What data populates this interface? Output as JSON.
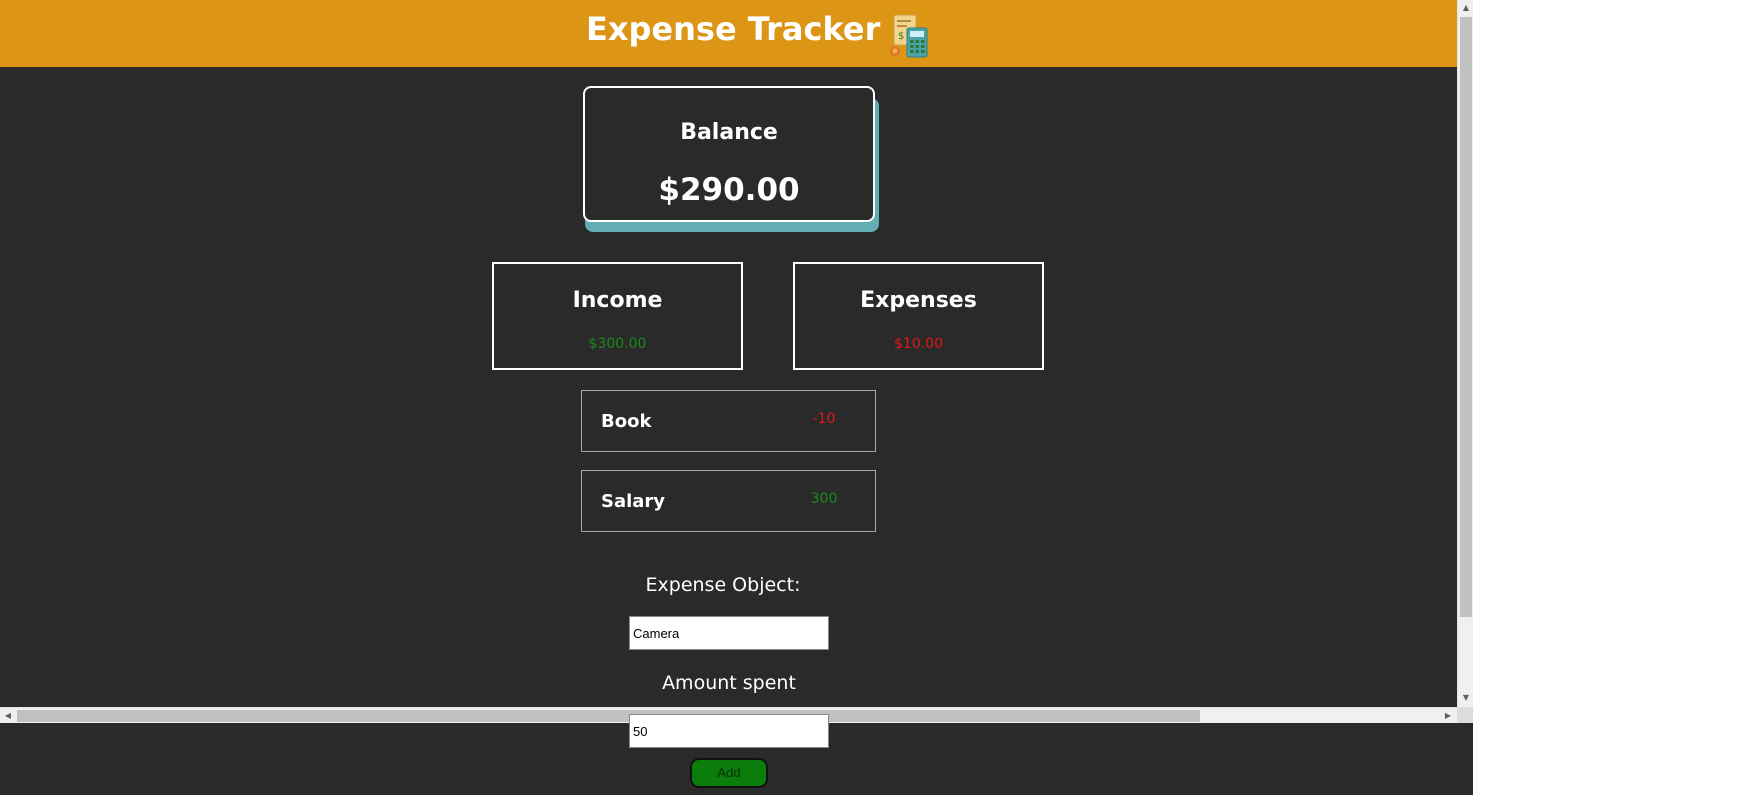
{
  "header": {
    "title": "Expense Tracker",
    "icon": "calculator-receipt-icon",
    "color": "#dc9515"
  },
  "balance": {
    "label": "Balance",
    "value": "$290.00"
  },
  "income": {
    "label": "Income",
    "value": "$300.00",
    "color": "#1a8a1a"
  },
  "expenses": {
    "label": "Expenses",
    "value": "$10.00",
    "color": "#e01818"
  },
  "transactions": [
    {
      "name": "Book",
      "amount": "-10",
      "type": "expense"
    },
    {
      "name": "Salary",
      "amount": "300",
      "type": "income"
    }
  ],
  "form": {
    "object_label": "Expense Object:",
    "object_value": "Camera",
    "amount_label": "Amount spent",
    "amount_value": "50",
    "add_label": "Add"
  },
  "colors": {
    "background": "#2b2a2b",
    "balance_shadow": "#62aeb2",
    "add_button": "#0a7d0a"
  }
}
